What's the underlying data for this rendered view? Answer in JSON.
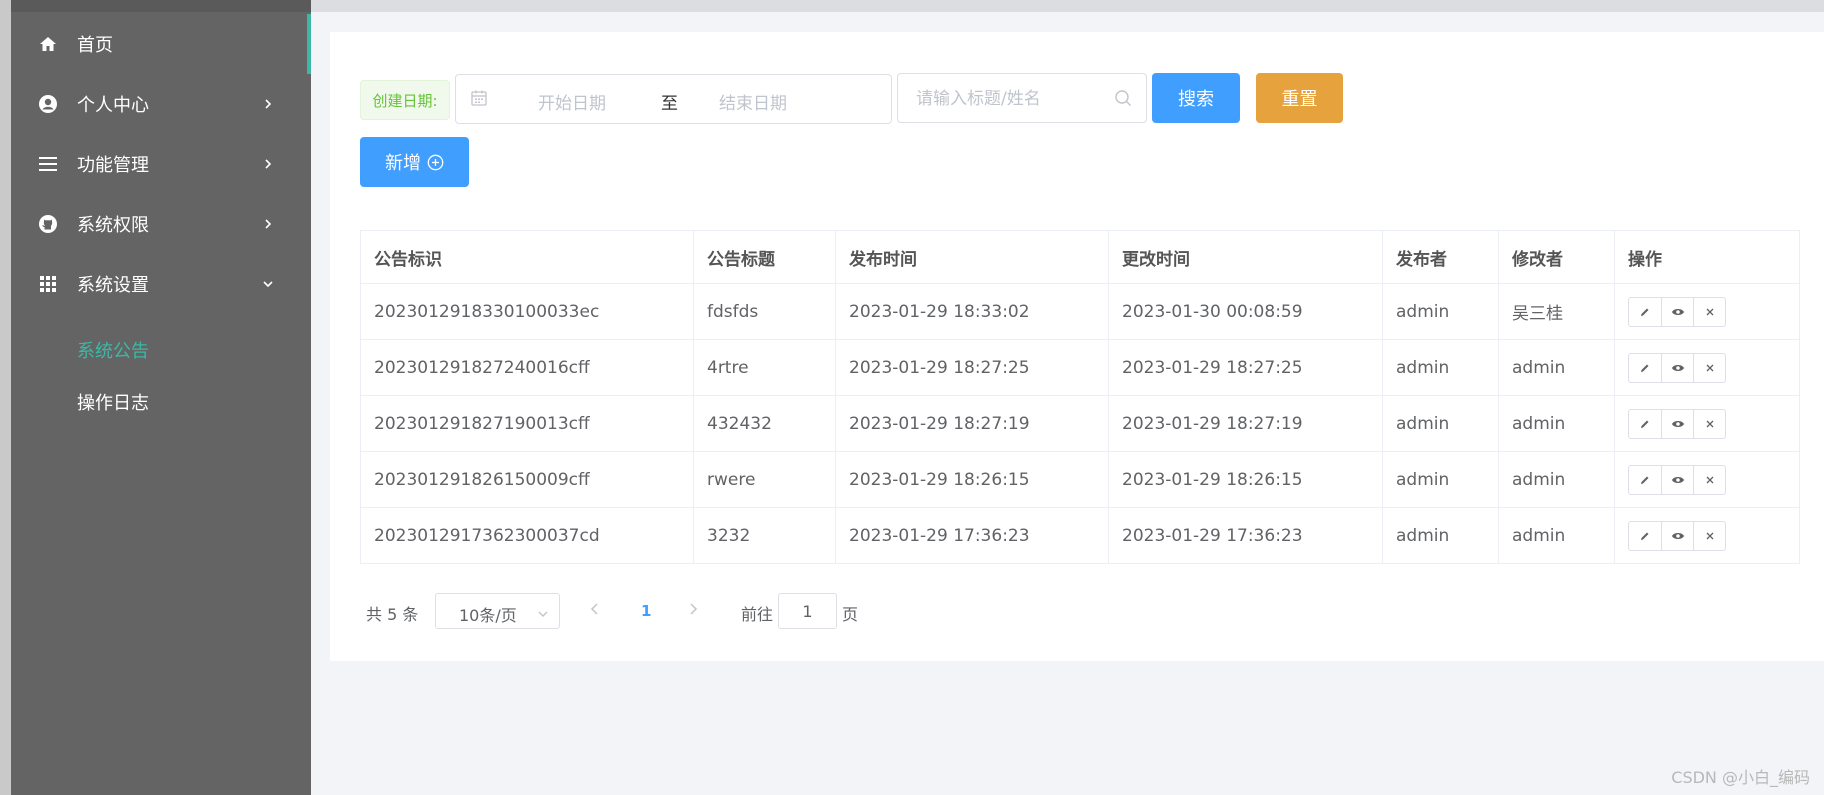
{
  "sidebar": {
    "items": [
      {
        "label": "首页",
        "icon": "home-icon",
        "has_arrow": false
      },
      {
        "label": "个人中心",
        "icon": "user-circle-icon",
        "has_arrow": true
      },
      {
        "label": "功能管理",
        "icon": "menu-lines-icon",
        "has_arrow": true
      },
      {
        "label": "系统权限",
        "icon": "github-icon",
        "has_arrow": true
      },
      {
        "label": "系统设置",
        "icon": "grid-icon",
        "has_arrow": true,
        "expanded": true
      }
    ],
    "submenu": [
      {
        "label": "系统公告",
        "active": true
      },
      {
        "label": "操作日志",
        "active": false
      }
    ],
    "active_color": "#3bb9a6"
  },
  "filters": {
    "date_label": "创建日期:",
    "start_placeholder": "开始日期",
    "range_separator": "至",
    "end_placeholder": "结束日期",
    "search_placeholder": "请输入标题/姓名",
    "search_button": "搜索",
    "reset_button": "重置",
    "add_button": "新增"
  },
  "table": {
    "columns": [
      "公告标识",
      "公告标题",
      "发布时间",
      "更改时间",
      "发布者",
      "修改者",
      "操作"
    ],
    "rows": [
      [
        "2023012918330100033ec",
        "fdsfds",
        "2023-01-29 18:33:02",
        "2023-01-30 00:08:59",
        "admin",
        "吴三桂"
      ],
      [
        "202301291827240016cff",
        "4rtre",
        "2023-01-29 18:27:25",
        "2023-01-29 18:27:25",
        "admin",
        "admin"
      ],
      [
        "202301291827190013cff",
        "432432",
        "2023-01-29 18:27:19",
        "2023-01-29 18:27:19",
        "admin",
        "admin"
      ],
      [
        "202301291826150009cff",
        "rwere",
        "2023-01-29 18:26:15",
        "2023-01-29 18:26:15",
        "admin",
        "admin"
      ],
      [
        "2023012917362300037cd",
        "3232",
        "2023-01-29 17:36:23",
        "2023-01-29 17:36:23",
        "admin",
        "admin"
      ]
    ],
    "actions": [
      "edit-icon",
      "view-icon",
      "delete-icon"
    ]
  },
  "pagination": {
    "total": "共 5 条",
    "page_size": "10条/页",
    "current_page": "1",
    "goto_label": "前往",
    "goto_value": "1",
    "goto_suffix": "页"
  },
  "watermark": "CSDN @小白_编码",
  "colors": {
    "sidebar_bg": "#646464",
    "primary": "#409eff",
    "warning": "#e6a23c",
    "success_tag": "#67c23a"
  }
}
